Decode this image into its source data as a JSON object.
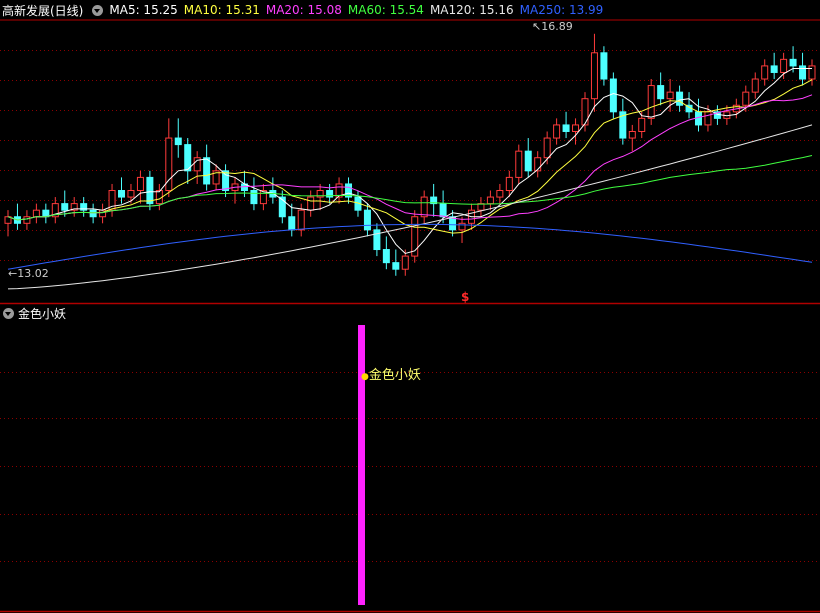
{
  "header": {
    "title": "高新发展(日线)",
    "ma": [
      {
        "label": "MA5: 15.25",
        "color": "#ffffff"
      },
      {
        "label": "MA10: 15.31",
        "color": "#ffff40"
      },
      {
        "label": "MA20: 15.08",
        "color": "#ff40ff"
      },
      {
        "label": "MA60: 15.54",
        "color": "#40ff40"
      },
      {
        "label": "MA120: 15.16",
        "color": "#e6e6e6"
      },
      {
        "label": "MA250: 13.99",
        "color": "#3060ff"
      }
    ]
  },
  "annotations": {
    "high": "16.89",
    "low": "13.02",
    "signal_marker": "$"
  },
  "indicator": {
    "title": "金色小妖",
    "signal_label": "金色小妖",
    "bar_color": "#ff22ff"
  },
  "colors": {
    "up": "#ff3b3b",
    "down": "#4dffff",
    "grid": "#8b0000",
    "frame": "#b00000"
  },
  "chart_data": {
    "type": "candlestick",
    "ylim": [
      12.8,
      17.1
    ],
    "candles": [
      [
        14.0,
        14.2,
        13.8,
        14.1
      ],
      [
        14.1,
        14.3,
        13.9,
        14.0
      ],
      [
        14.0,
        14.2,
        13.9,
        14.1
      ],
      [
        14.1,
        14.3,
        14.0,
        14.2
      ],
      [
        14.2,
        14.3,
        14.0,
        14.1
      ],
      [
        14.1,
        14.4,
        14.0,
        14.3
      ],
      [
        14.3,
        14.5,
        14.1,
        14.2
      ],
      [
        14.2,
        14.4,
        14.1,
        14.3
      ],
      [
        14.3,
        14.4,
        14.1,
        14.2
      ],
      [
        14.2,
        14.3,
        14.0,
        14.1
      ],
      [
        14.1,
        14.3,
        14.0,
        14.2
      ],
      [
        14.2,
        14.6,
        14.1,
        14.5
      ],
      [
        14.5,
        14.7,
        14.3,
        14.4
      ],
      [
        14.4,
        14.6,
        14.3,
        14.5
      ],
      [
        14.5,
        14.8,
        14.3,
        14.7
      ],
      [
        14.7,
        14.8,
        14.2,
        14.3
      ],
      [
        14.3,
        14.6,
        14.2,
        14.5
      ],
      [
        14.5,
        15.6,
        14.4,
        15.3
      ],
      [
        15.3,
        15.6,
        15.0,
        15.2
      ],
      [
        15.2,
        15.3,
        14.6,
        14.8
      ],
      [
        14.8,
        15.1,
        14.6,
        15.0
      ],
      [
        15.0,
        15.2,
        14.5,
        14.6
      ],
      [
        14.6,
        14.9,
        14.5,
        14.8
      ],
      [
        14.8,
        14.9,
        14.4,
        14.5
      ],
      [
        14.5,
        14.7,
        14.3,
        14.6
      ],
      [
        14.6,
        14.8,
        14.4,
        14.5
      ],
      [
        14.5,
        14.7,
        14.2,
        14.3
      ],
      [
        14.3,
        14.6,
        14.2,
        14.5
      ],
      [
        14.5,
        14.7,
        14.3,
        14.4
      ],
      [
        14.4,
        14.5,
        14.0,
        14.1
      ],
      [
        14.1,
        14.3,
        13.8,
        13.9
      ],
      [
        13.9,
        14.3,
        13.8,
        14.2
      ],
      [
        14.2,
        14.5,
        14.1,
        14.4
      ],
      [
        14.4,
        14.6,
        14.2,
        14.5
      ],
      [
        14.5,
        14.6,
        14.3,
        14.4
      ],
      [
        14.4,
        14.7,
        14.3,
        14.6
      ],
      [
        14.6,
        14.7,
        14.3,
        14.4
      ],
      [
        14.4,
        14.5,
        14.1,
        14.2
      ],
      [
        14.2,
        14.3,
        13.8,
        13.9
      ],
      [
        13.9,
        14.0,
        13.5,
        13.6
      ],
      [
        13.6,
        13.8,
        13.3,
        13.4
      ],
      [
        13.4,
        13.6,
        13.2,
        13.3
      ],
      [
        13.3,
        13.6,
        13.2,
        13.5
      ],
      [
        13.5,
        14.2,
        13.4,
        14.1
      ],
      [
        14.1,
        14.5,
        14.0,
        14.4
      ],
      [
        14.4,
        14.6,
        14.1,
        14.3
      ],
      [
        14.3,
        14.5,
        14.0,
        14.1
      ],
      [
        14.1,
        14.2,
        13.8,
        13.9
      ],
      [
        13.9,
        14.1,
        13.7,
        14.0
      ],
      [
        14.0,
        14.3,
        13.9,
        14.2
      ],
      [
        14.2,
        14.4,
        14.1,
        14.3
      ],
      [
        14.3,
        14.5,
        14.2,
        14.4
      ],
      [
        14.4,
        14.6,
        14.3,
        14.5
      ],
      [
        14.5,
        14.8,
        14.4,
        14.7
      ],
      [
        14.7,
        15.2,
        14.6,
        15.1
      ],
      [
        15.1,
        15.3,
        14.7,
        14.8
      ],
      [
        14.8,
        15.1,
        14.7,
        15.0
      ],
      [
        15.0,
        15.4,
        14.9,
        15.3
      ],
      [
        15.3,
        15.6,
        15.2,
        15.5
      ],
      [
        15.5,
        15.7,
        15.3,
        15.4
      ],
      [
        15.4,
        15.6,
        15.2,
        15.5
      ],
      [
        15.5,
        16.0,
        15.4,
        15.9
      ],
      [
        15.9,
        16.89,
        15.7,
        16.6
      ],
      [
        16.6,
        16.7,
        16.1,
        16.2
      ],
      [
        16.2,
        16.3,
        15.6,
        15.7
      ],
      [
        15.7,
        15.9,
        15.2,
        15.3
      ],
      [
        15.3,
        15.5,
        15.1,
        15.4
      ],
      [
        15.4,
        15.7,
        15.3,
        15.6
      ],
      [
        15.6,
        16.2,
        15.5,
        16.1
      ],
      [
        16.1,
        16.3,
        15.8,
        15.9
      ],
      [
        15.9,
        16.2,
        15.7,
        16.0
      ],
      [
        16.0,
        16.1,
        15.7,
        15.8
      ],
      [
        15.8,
        16.0,
        15.6,
        15.7
      ],
      [
        15.7,
        15.9,
        15.4,
        15.5
      ],
      [
        15.5,
        15.8,
        15.4,
        15.7
      ],
      [
        15.7,
        15.8,
        15.5,
        15.6
      ],
      [
        15.6,
        15.8,
        15.5,
        15.7
      ],
      [
        15.7,
        15.9,
        15.6,
        15.8
      ],
      [
        15.8,
        16.1,
        15.7,
        16.0
      ],
      [
        16.0,
        16.3,
        15.9,
        16.2
      ],
      [
        16.2,
        16.5,
        16.1,
        16.4
      ],
      [
        16.4,
        16.6,
        16.2,
        16.3
      ],
      [
        16.3,
        16.6,
        16.2,
        16.5
      ],
      [
        16.5,
        16.7,
        16.3,
        16.4
      ],
      [
        16.4,
        16.6,
        16.1,
        16.2
      ],
      [
        16.2,
        16.5,
        16.1,
        16.4
      ]
    ],
    "signal_index": 43
  }
}
